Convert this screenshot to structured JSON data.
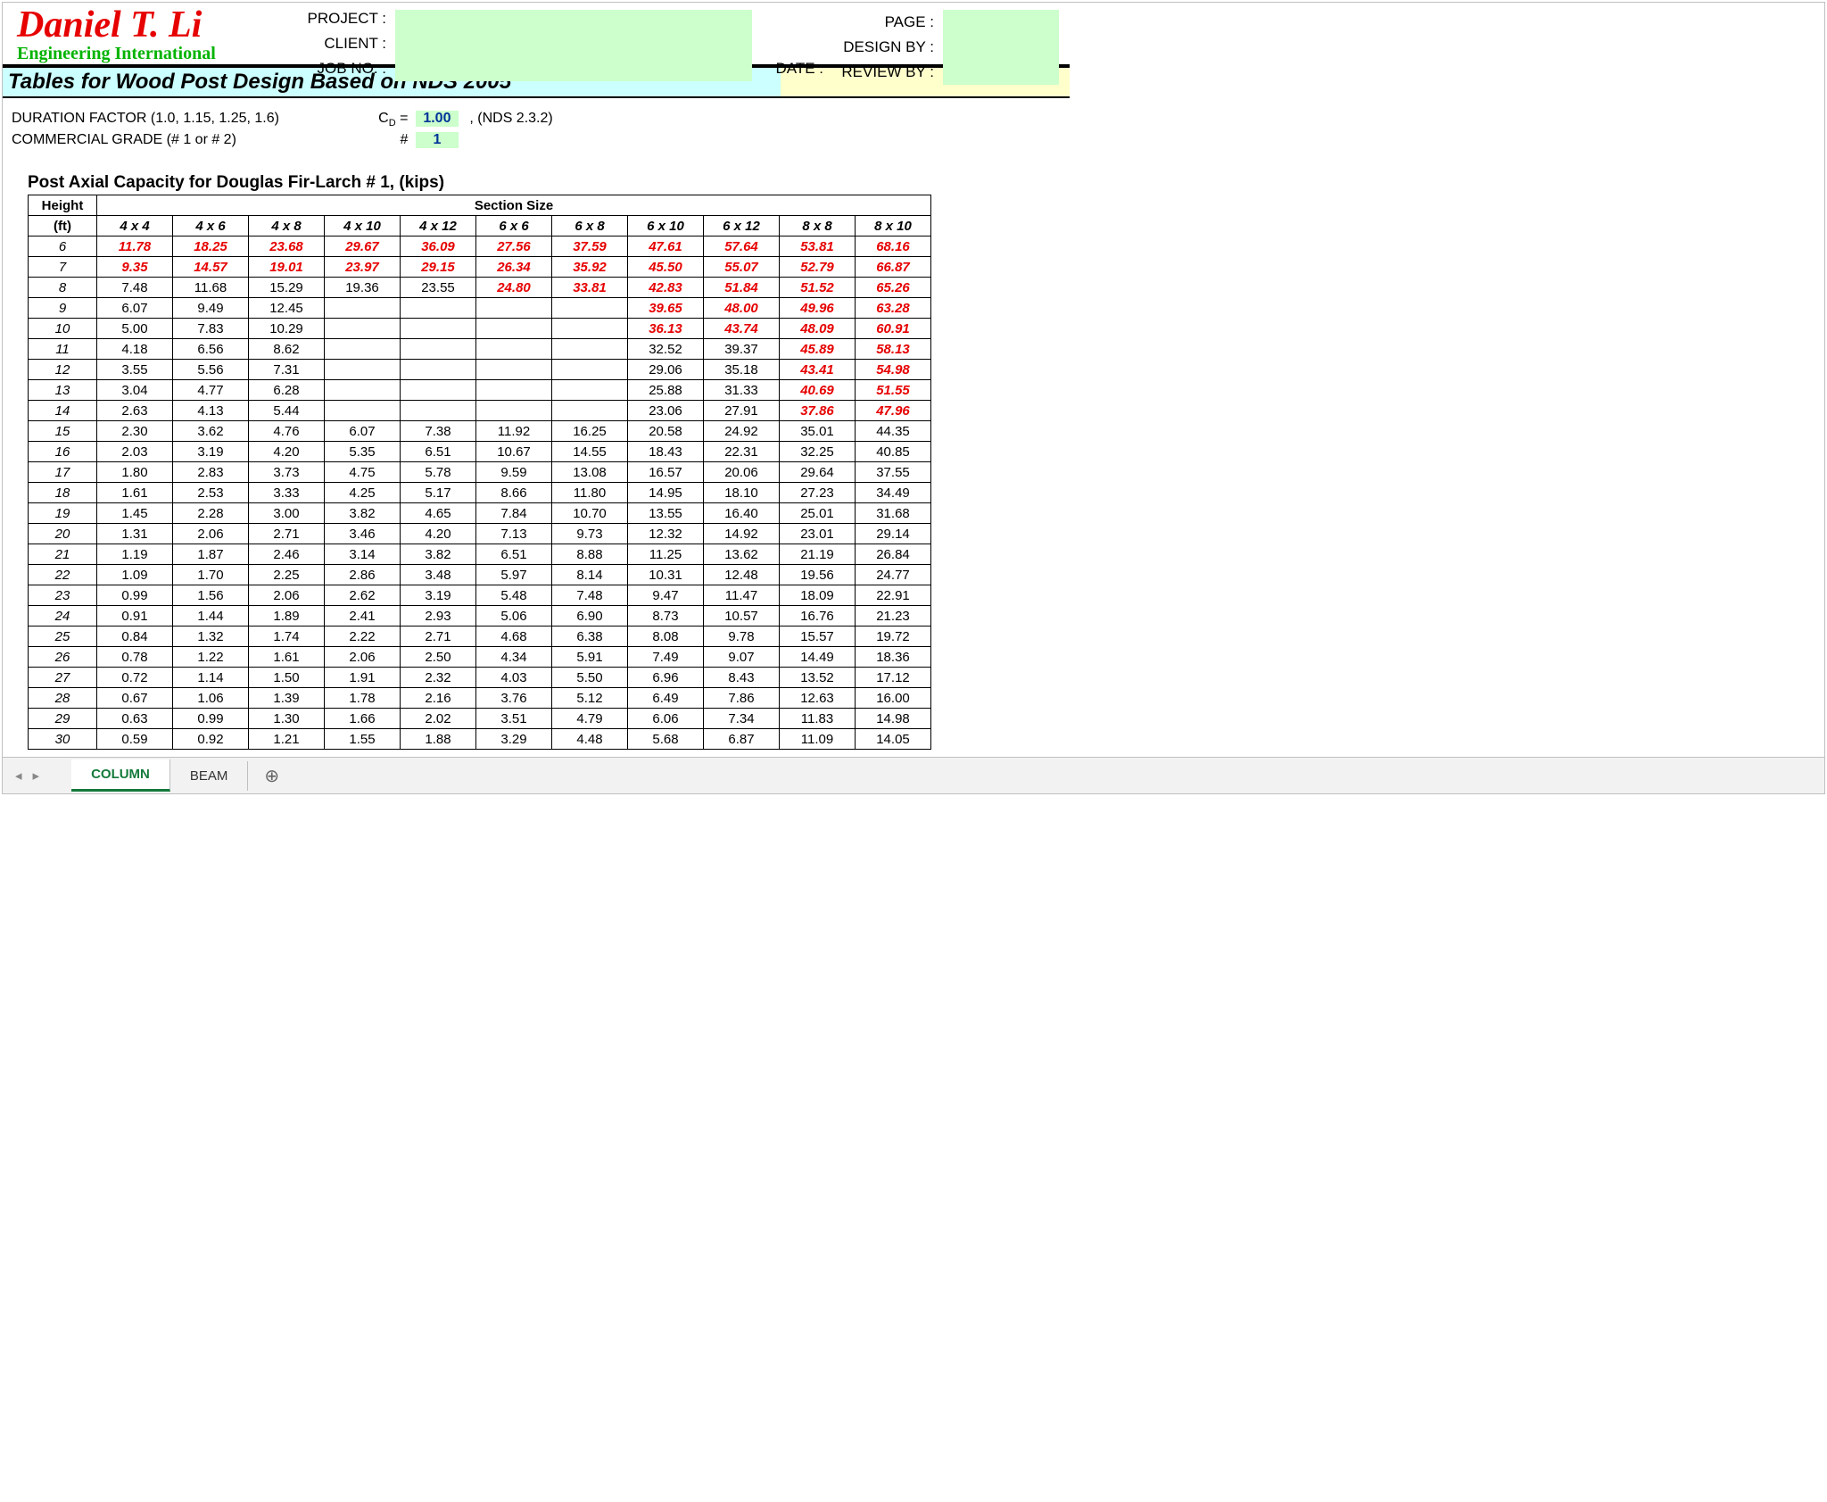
{
  "company": {
    "name": "Daniel T. Li",
    "sub": "Engineering International"
  },
  "header": {
    "project_label": "PROJECT :",
    "client_label": "CLIENT :",
    "jobno_label": "JOB NO. :",
    "date_label": "DATE :",
    "page_label": "PAGE :",
    "designby_label": "DESIGN BY :",
    "reviewby_label": "REVIEW BY :"
  },
  "title": "Tables for Wood Post Design Based on NDS 2005",
  "params": {
    "duration_label": "DURATION FACTOR (1.0, 1.15, 1.25, 1.6)",
    "duration_sym": "C",
    "duration_value": "1.00",
    "duration_note": ",  (NDS 2.3.2)",
    "grade_label": "COMMERCIAL GRADE (# 1 or # 2)",
    "grade_sym": "#",
    "grade_value": "1"
  },
  "subtitle": "Post Axial Capacity for Douglas Fir-Larch # 1, (kips)",
  "columns": [
    "4 x 4",
    "4 x 6",
    "4 x 8",
    "4 x 10",
    "4 x 12",
    "6 x 6",
    "6 x 8",
    "6 x 10",
    "6 x 12",
    "8 x 8",
    "8 x 10"
  ],
  "section_header": "Section Size",
  "height_label_top": "Height",
  "height_label_bot": "(ft)",
  "chart_data": {
    "type": "table",
    "title": "Post Axial Capacity for Douglas Fir-Larch # 1, (kips)",
    "xlabel": "Section Size",
    "ylabel": "Height (ft)",
    "columns": [
      "4 x 4",
      "4 x 6",
      "4 x 8",
      "4 x 10",
      "4 x 12",
      "6 x 6",
      "6 x 8",
      "6 x 10",
      "6 x 12",
      "8 x 8",
      "8 x 10"
    ],
    "rows": [
      {
        "h": "6",
        "v": [
          {
            "n": "11.78",
            "r": 1
          },
          {
            "n": "18.25",
            "r": 1
          },
          {
            "n": "23.68",
            "r": 1
          },
          {
            "n": "29.67",
            "r": 1
          },
          {
            "n": "36.09",
            "r": 1
          },
          {
            "n": "27.56",
            "r": 1
          },
          {
            "n": "37.59",
            "r": 1
          },
          {
            "n": "47.61",
            "r": 1
          },
          {
            "n": "57.64",
            "r": 1
          },
          {
            "n": "53.81",
            "r": 1
          },
          {
            "n": "68.16",
            "r": 1
          }
        ]
      },
      {
        "h": "7",
        "v": [
          {
            "n": "9.35",
            "r": 1
          },
          {
            "n": "14.57",
            "r": 1
          },
          {
            "n": "19.01",
            "r": 1
          },
          {
            "n": "23.97",
            "r": 1
          },
          {
            "n": "29.15",
            "r": 1
          },
          {
            "n": "26.34",
            "r": 1
          },
          {
            "n": "35.92",
            "r": 1
          },
          {
            "n": "45.50",
            "r": 1
          },
          {
            "n": "55.07",
            "r": 1
          },
          {
            "n": "52.79",
            "r": 1
          },
          {
            "n": "66.87",
            "r": 1
          }
        ]
      },
      {
        "h": "8",
        "v": [
          {
            "n": "7.48"
          },
          {
            "n": "11.68"
          },
          {
            "n": "15.29"
          },
          {
            "n": "19.36"
          },
          {
            "n": "23.55"
          },
          {
            "n": "24.80",
            "r": 1
          },
          {
            "n": "33.81",
            "r": 1
          },
          {
            "n": "42.83",
            "r": 1
          },
          {
            "n": "51.84",
            "r": 1
          },
          {
            "n": "51.52",
            "r": 1
          },
          {
            "n": "65.26",
            "r": 1
          }
        ]
      },
      {
        "h": "9",
        "v": [
          {
            "n": "6.07"
          },
          {
            "n": "9.49"
          },
          {
            "n": "12.45"
          },
          {
            "n": ""
          },
          {
            "n": ""
          },
          {
            "n": ""
          },
          {
            "n": ""
          },
          {
            "n": "39.65",
            "r": 1
          },
          {
            "n": "48.00",
            "r": 1
          },
          {
            "n": "49.96",
            "r": 1
          },
          {
            "n": "63.28",
            "r": 1
          }
        ]
      },
      {
        "h": "10",
        "v": [
          {
            "n": "5.00"
          },
          {
            "n": "7.83"
          },
          {
            "n": "10.29"
          },
          {
            "n": ""
          },
          {
            "n": ""
          },
          {
            "n": ""
          },
          {
            "n": ""
          },
          {
            "n": "36.13",
            "r": 1
          },
          {
            "n": "43.74",
            "r": 1
          },
          {
            "n": "48.09",
            "r": 1
          },
          {
            "n": "60.91",
            "r": 1
          }
        ]
      },
      {
        "h": "11",
        "v": [
          {
            "n": "4.18"
          },
          {
            "n": "6.56"
          },
          {
            "n": "8.62"
          },
          {
            "n": ""
          },
          {
            "n": ""
          },
          {
            "n": ""
          },
          {
            "n": ""
          },
          {
            "n": "32.52"
          },
          {
            "n": "39.37"
          },
          {
            "n": "45.89",
            "r": 1
          },
          {
            "n": "58.13",
            "r": 1
          }
        ]
      },
      {
        "h": "12",
        "v": [
          {
            "n": "3.55"
          },
          {
            "n": "5.56"
          },
          {
            "n": "7.31"
          },
          {
            "n": ""
          },
          {
            "n": ""
          },
          {
            "n": ""
          },
          {
            "n": ""
          },
          {
            "n": "29.06"
          },
          {
            "n": "35.18"
          },
          {
            "n": "43.41",
            "r": 1
          },
          {
            "n": "54.98",
            "r": 1
          }
        ]
      },
      {
        "h": "13",
        "v": [
          {
            "n": "3.04"
          },
          {
            "n": "4.77"
          },
          {
            "n": "6.28"
          },
          {
            "n": ""
          },
          {
            "n": ""
          },
          {
            "n": ""
          },
          {
            "n": ""
          },
          {
            "n": "25.88"
          },
          {
            "n": "31.33"
          },
          {
            "n": "40.69",
            "r": 1
          },
          {
            "n": "51.55",
            "r": 1
          }
        ]
      },
      {
        "h": "14",
        "v": [
          {
            "n": "2.63"
          },
          {
            "n": "4.13"
          },
          {
            "n": "5.44"
          },
          {
            "n": ""
          },
          {
            "n": ""
          },
          {
            "n": ""
          },
          {
            "n": ""
          },
          {
            "n": "23.06"
          },
          {
            "n": "27.91"
          },
          {
            "n": "37.86",
            "r": 1
          },
          {
            "n": "47.96",
            "r": 1
          }
        ]
      },
      {
        "h": "15",
        "v": [
          {
            "n": "2.30"
          },
          {
            "n": "3.62"
          },
          {
            "n": "4.76"
          },
          {
            "n": "6.07"
          },
          {
            "n": "7.38"
          },
          {
            "n": "11.92"
          },
          {
            "n": "16.25"
          },
          {
            "n": "20.58"
          },
          {
            "n": "24.92"
          },
          {
            "n": "35.01"
          },
          {
            "n": "44.35"
          }
        ]
      },
      {
        "h": "16",
        "v": [
          {
            "n": "2.03"
          },
          {
            "n": "3.19"
          },
          {
            "n": "4.20"
          },
          {
            "n": "5.35"
          },
          {
            "n": "6.51"
          },
          {
            "n": "10.67"
          },
          {
            "n": "14.55"
          },
          {
            "n": "18.43"
          },
          {
            "n": "22.31"
          },
          {
            "n": "32.25"
          },
          {
            "n": "40.85"
          }
        ]
      },
      {
        "h": "17",
        "v": [
          {
            "n": "1.80"
          },
          {
            "n": "2.83"
          },
          {
            "n": "3.73"
          },
          {
            "n": "4.75"
          },
          {
            "n": "5.78"
          },
          {
            "n": "9.59"
          },
          {
            "n": "13.08"
          },
          {
            "n": "16.57"
          },
          {
            "n": "20.06"
          },
          {
            "n": "29.64"
          },
          {
            "n": "37.55"
          }
        ]
      },
      {
        "h": "18",
        "v": [
          {
            "n": "1.61"
          },
          {
            "n": "2.53"
          },
          {
            "n": "3.33"
          },
          {
            "n": "4.25"
          },
          {
            "n": "5.17"
          },
          {
            "n": "8.66"
          },
          {
            "n": "11.80"
          },
          {
            "n": "14.95"
          },
          {
            "n": "18.10"
          },
          {
            "n": "27.23"
          },
          {
            "n": "34.49"
          }
        ]
      },
      {
        "h": "19",
        "v": [
          {
            "n": "1.45"
          },
          {
            "n": "2.28"
          },
          {
            "n": "3.00"
          },
          {
            "n": "3.82"
          },
          {
            "n": "4.65"
          },
          {
            "n": "7.84"
          },
          {
            "n": "10.70"
          },
          {
            "n": "13.55"
          },
          {
            "n": "16.40"
          },
          {
            "n": "25.01"
          },
          {
            "n": "31.68"
          }
        ]
      },
      {
        "h": "20",
        "v": [
          {
            "n": "1.31"
          },
          {
            "n": "2.06"
          },
          {
            "n": "2.71"
          },
          {
            "n": "3.46"
          },
          {
            "n": "4.20"
          },
          {
            "n": "7.13"
          },
          {
            "n": "9.73"
          },
          {
            "n": "12.32"
          },
          {
            "n": "14.92"
          },
          {
            "n": "23.01"
          },
          {
            "n": "29.14"
          }
        ]
      },
      {
        "h": "21",
        "v": [
          {
            "n": "1.19"
          },
          {
            "n": "1.87"
          },
          {
            "n": "2.46"
          },
          {
            "n": "3.14"
          },
          {
            "n": "3.82"
          },
          {
            "n": "6.51"
          },
          {
            "n": "8.88"
          },
          {
            "n": "11.25"
          },
          {
            "n": "13.62"
          },
          {
            "n": "21.19"
          },
          {
            "n": "26.84"
          }
        ]
      },
      {
        "h": "22",
        "v": [
          {
            "n": "1.09"
          },
          {
            "n": "1.70"
          },
          {
            "n": "2.25"
          },
          {
            "n": "2.86"
          },
          {
            "n": "3.48"
          },
          {
            "n": "5.97"
          },
          {
            "n": "8.14"
          },
          {
            "n": "10.31"
          },
          {
            "n": "12.48"
          },
          {
            "n": "19.56"
          },
          {
            "n": "24.77"
          }
        ]
      },
      {
        "h": "23",
        "v": [
          {
            "n": "0.99"
          },
          {
            "n": "1.56"
          },
          {
            "n": "2.06"
          },
          {
            "n": "2.62"
          },
          {
            "n": "3.19"
          },
          {
            "n": "5.48"
          },
          {
            "n": "7.48"
          },
          {
            "n": "9.47"
          },
          {
            "n": "11.47"
          },
          {
            "n": "18.09"
          },
          {
            "n": "22.91"
          }
        ]
      },
      {
        "h": "24",
        "v": [
          {
            "n": "0.91"
          },
          {
            "n": "1.44"
          },
          {
            "n": "1.89"
          },
          {
            "n": "2.41"
          },
          {
            "n": "2.93"
          },
          {
            "n": "5.06"
          },
          {
            "n": "6.90"
          },
          {
            "n": "8.73"
          },
          {
            "n": "10.57"
          },
          {
            "n": "16.76"
          },
          {
            "n": "21.23"
          }
        ]
      },
      {
        "h": "25",
        "v": [
          {
            "n": "0.84"
          },
          {
            "n": "1.32"
          },
          {
            "n": "1.74"
          },
          {
            "n": "2.22"
          },
          {
            "n": "2.71"
          },
          {
            "n": "4.68"
          },
          {
            "n": "6.38"
          },
          {
            "n": "8.08"
          },
          {
            "n": "9.78"
          },
          {
            "n": "15.57"
          },
          {
            "n": "19.72"
          }
        ]
      },
      {
        "h": "26",
        "v": [
          {
            "n": "0.78"
          },
          {
            "n": "1.22"
          },
          {
            "n": "1.61"
          },
          {
            "n": "2.06"
          },
          {
            "n": "2.50"
          },
          {
            "n": "4.34"
          },
          {
            "n": "5.91"
          },
          {
            "n": "7.49"
          },
          {
            "n": "9.07"
          },
          {
            "n": "14.49"
          },
          {
            "n": "18.36"
          }
        ]
      },
      {
        "h": "27",
        "v": [
          {
            "n": "0.72"
          },
          {
            "n": "1.14"
          },
          {
            "n": "1.50"
          },
          {
            "n": "1.91"
          },
          {
            "n": "2.32"
          },
          {
            "n": "4.03"
          },
          {
            "n": "5.50"
          },
          {
            "n": "6.96"
          },
          {
            "n": "8.43"
          },
          {
            "n": "13.52"
          },
          {
            "n": "17.12"
          }
        ]
      },
      {
        "h": "28",
        "v": [
          {
            "n": "0.67"
          },
          {
            "n": "1.06"
          },
          {
            "n": "1.39"
          },
          {
            "n": "1.78"
          },
          {
            "n": "2.16"
          },
          {
            "n": "3.76"
          },
          {
            "n": "5.12"
          },
          {
            "n": "6.49"
          },
          {
            "n": "7.86"
          },
          {
            "n": "12.63"
          },
          {
            "n": "16.00"
          }
        ]
      },
      {
        "h": "29",
        "v": [
          {
            "n": "0.63"
          },
          {
            "n": "0.99"
          },
          {
            "n": "1.30"
          },
          {
            "n": "1.66"
          },
          {
            "n": "2.02"
          },
          {
            "n": "3.51"
          },
          {
            "n": "4.79"
          },
          {
            "n": "6.06"
          },
          {
            "n": "7.34"
          },
          {
            "n": "11.83"
          },
          {
            "n": "14.98"
          }
        ]
      },
      {
        "h": "30",
        "v": [
          {
            "n": "0.59"
          },
          {
            "n": "0.92"
          },
          {
            "n": "1.21"
          },
          {
            "n": "1.55"
          },
          {
            "n": "1.88"
          },
          {
            "n": "3.29"
          },
          {
            "n": "4.48"
          },
          {
            "n": "5.68"
          },
          {
            "n": "6.87"
          },
          {
            "n": "11.09"
          },
          {
            "n": "14.05"
          }
        ]
      }
    ]
  },
  "tabs": {
    "active": "COLUMN",
    "other": "BEAM"
  }
}
